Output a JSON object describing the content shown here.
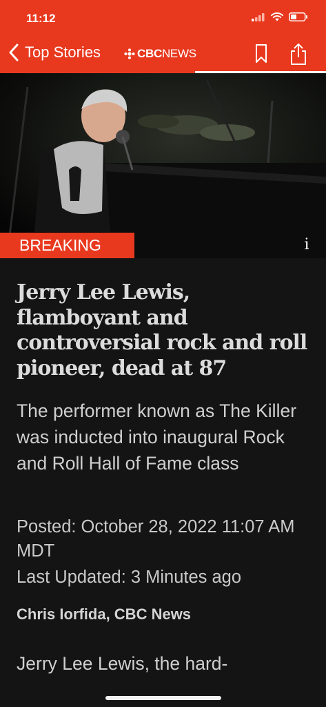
{
  "status_bar": {
    "time": "11:12"
  },
  "nav": {
    "back_label": "Top Stories",
    "brand_cbc": "CBC",
    "brand_news": "NEWS"
  },
  "hero": {
    "alt": "Jerry Lee Lewis performing at a piano on a dark stage",
    "breaking_label": "BREAKING",
    "info_icon": "info-icon"
  },
  "article": {
    "headline": "Jerry Lee Lewis, flamboyant and controversial rock and roll pioneer, dead at 87",
    "deck": "The performer known as The Killer was inducted into inaugural Rock and Roll Hall of Fame class",
    "posted": "Posted: October 28, 2022 11:07 AM MDT",
    "updated": "Last Updated: 3 Minutes ago",
    "byline": "Chris Iorfida, CBC News",
    "body_start": "Jerry Lee Lewis, the hard-"
  },
  "colors": {
    "accent": "#e8391f",
    "background": "#141414",
    "text": "#d9d9d9"
  },
  "icons": [
    "signal-icon",
    "wifi-icon",
    "battery-icon",
    "back-chevron-icon",
    "cbc-gem-icon",
    "bookmark-icon",
    "share-icon",
    "info-icon"
  ]
}
